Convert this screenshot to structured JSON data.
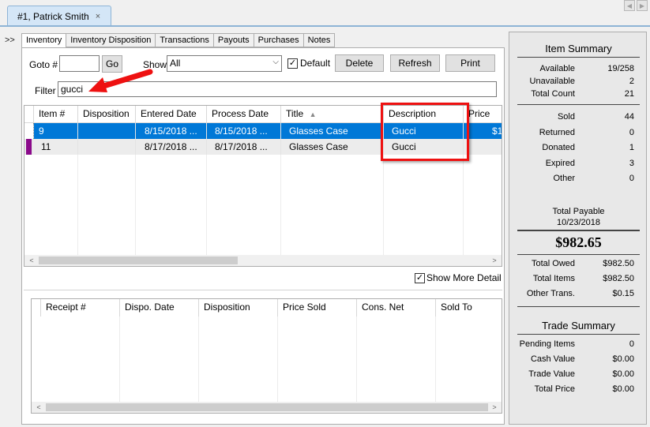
{
  "document_tab": {
    "label": "#1, Patrick Smith",
    "close_icon": "×"
  },
  "expander": ">>",
  "subtabs": [
    "Inventory",
    "Inventory Disposition",
    "Transactions",
    "Payouts",
    "Purchases",
    "Notes"
  ],
  "toolbar": {
    "goto_label": "Goto #",
    "goto_value": "",
    "go_button": "Go",
    "show_label": "Show",
    "show_value": "All",
    "default_label": "Default",
    "default_checked": true,
    "delete_button": "Delete",
    "refresh_button": "Refresh",
    "print_button": "Print",
    "filter_label": "Filter",
    "filter_value": "gucci"
  },
  "grid": {
    "columns": [
      "Item #",
      "Disposition",
      "Entered Date",
      "Process Date",
      "Title",
      "Description",
      "Price"
    ],
    "rows": [
      {
        "item": "9",
        "disposition": "",
        "entered": "8/15/2018 ...",
        "process": "8/15/2018 ...",
        "title": "Glasses Case",
        "description": "Gucci",
        "price": "$1",
        "selected": true
      },
      {
        "item": "11",
        "disposition": "",
        "entered": "8/17/2018 ...",
        "process": "8/17/2018 ...",
        "title": "Glasses Case",
        "description": "Gucci",
        "price": "",
        "marker_color": "#8b0a8b"
      }
    ]
  },
  "show_more_detail": {
    "label": "Show More Detail",
    "checked": true
  },
  "detail_grid": {
    "columns": [
      "Receipt #",
      "Dispo. Date",
      "Disposition",
      "Price Sold",
      "Cons. Net",
      "Sold To"
    ]
  },
  "item_summary": {
    "title": "Item Summary",
    "group1": [
      {
        "k": "Available",
        "v": "19/258"
      },
      {
        "k": "Unavailable",
        "v": "2"
      },
      {
        "k": "Total Count",
        "v": "21"
      }
    ],
    "group2": [
      {
        "k": "Sold",
        "v": "44"
      },
      {
        "k": "Returned",
        "v": "0"
      },
      {
        "k": "Donated",
        "v": "1"
      },
      {
        "k": "Expired",
        "v": "3"
      },
      {
        "k": "Other",
        "v": "0"
      }
    ],
    "total_payable_label": "Total Payable",
    "total_payable_date": "10/23/2018",
    "total_payable_value": "$982.65",
    "group3": [
      {
        "k": "Total Owed",
        "v": "$982.50"
      },
      {
        "k": "Total Items",
        "v": "$982.50"
      },
      {
        "k": "Other Trans.",
        "v": "$0.15"
      }
    ]
  },
  "trade_summary": {
    "title": "Trade Summary",
    "rows": [
      {
        "k": "Pending Items",
        "v": "0"
      },
      {
        "k": "Cash Value",
        "v": "$0.00"
      },
      {
        "k": "Trade Value",
        "v": "$0.00"
      },
      {
        "k": "Total Price",
        "v": "$0.00"
      }
    ]
  },
  "colors": {
    "selection": "#0078d7",
    "annotation": "#e11111",
    "row_marker": "#8b0a8b"
  }
}
